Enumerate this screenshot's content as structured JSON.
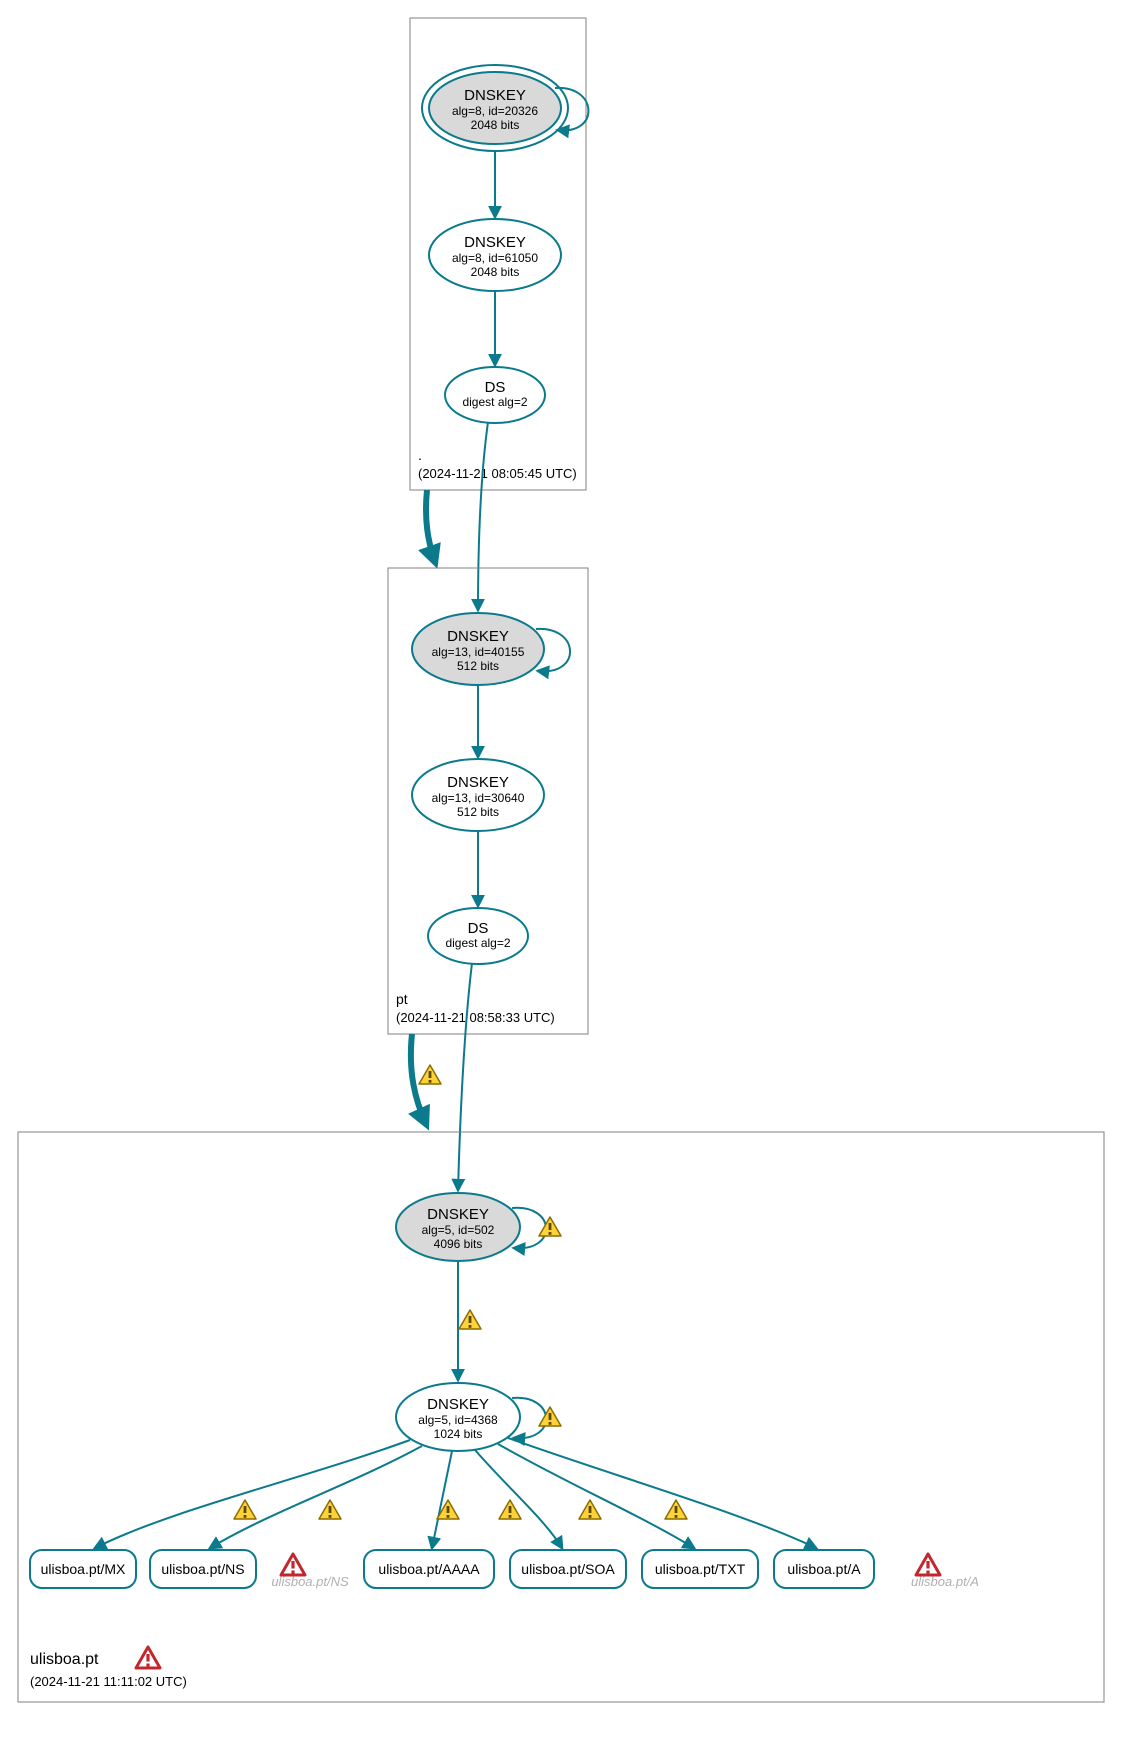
{
  "colors": {
    "teal": "#0a7a8c",
    "grey_fill": "#d9d9d9",
    "warn_fill": "#ffd23a",
    "warn_stroke": "#8a6d00",
    "err_stroke": "#c1272d"
  },
  "zones": {
    "root": {
      "label": ".",
      "timestamp": "(2024-11-21 08:05:45 UTC)",
      "nodes": {
        "ksk": {
          "title": "DNSKEY",
          "line1": "alg=8, id=20326",
          "line2": "2048 bits"
        },
        "zsk": {
          "title": "DNSKEY",
          "line1": "alg=8, id=61050",
          "line2": "2048 bits"
        },
        "ds": {
          "title": "DS",
          "line1": "digest alg=2"
        }
      }
    },
    "pt": {
      "label": "pt",
      "timestamp": "(2024-11-21 08:58:33 UTC)",
      "nodes": {
        "ksk": {
          "title": "DNSKEY",
          "line1": "alg=13, id=40155",
          "line2": "512 bits"
        },
        "zsk": {
          "title": "DNSKEY",
          "line1": "alg=13, id=30640",
          "line2": "512 bits"
        },
        "ds": {
          "title": "DS",
          "line1": "digest alg=2"
        }
      }
    },
    "ulisboa": {
      "label": "ulisboa.pt",
      "timestamp": "(2024-11-21 11:11:02 UTC)",
      "nodes": {
        "ksk": {
          "title": "DNSKEY",
          "line1": "alg=5, id=502",
          "line2": "4096 bits"
        },
        "zsk": {
          "title": "DNSKEY",
          "line1": "alg=5, id=4368",
          "line2": "1024 bits"
        }
      },
      "rrsets": [
        {
          "label": "ulisboa.pt/MX"
        },
        {
          "label": "ulisboa.pt/NS"
        },
        {
          "label": "ulisboa.pt/AAAA"
        },
        {
          "label": "ulisboa.pt/SOA"
        },
        {
          "label": "ulisboa.pt/TXT"
        },
        {
          "label": "ulisboa.pt/A"
        }
      ],
      "ghosts": [
        {
          "label": "ulisboa.pt/NS"
        },
        {
          "label": "ulisboa.pt/A"
        }
      ]
    }
  }
}
